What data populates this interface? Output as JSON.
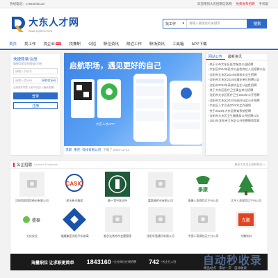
{
  "topbar": {
    "left": "热线电话：17553645120",
    "welcome": "欢迎来到大东招聘信息网",
    "post": "免费发布招聘",
    "mobile": "手机版"
  },
  "logo": {
    "title": "大东人才网",
    "url": "www.sydrcw.com"
  },
  "search": {
    "select": "找工作",
    "placeholder": "请输入要搜索的关键字",
    "button": "搜索"
  },
  "nav": [
    {
      "label": "首页",
      "active": true,
      "badge": ""
    },
    {
      "label": "找工作",
      "active": false,
      "badge": ""
    },
    {
      "label": "找企业",
      "active": false,
      "badge": "new"
    },
    {
      "label": "找兼职",
      "active": false,
      "badge": ""
    },
    {
      "label": "公招",
      "active": false,
      "badge": ""
    },
    {
      "label": "职位资讯",
      "active": false,
      "badge": ""
    },
    {
      "label": "附近工作",
      "active": false,
      "badge": ""
    },
    {
      "label": "职场资讯",
      "active": false,
      "badge": ""
    },
    {
      "label": "工具箱",
      "active": false,
      "badge": ""
    },
    {
      "label": "APP下载",
      "active": false,
      "badge": ""
    }
  ],
  "login": {
    "title": "快捷登录/注册",
    "sub": "请使用验证码登录/注册",
    "phone_placeholder": "请输入手机号",
    "code_placeholder": "请输入验证码",
    "code_button": "获取验证码",
    "agree": "已阅读并同意《用户协议》《隐私政策》",
    "login_button": "登录",
    "register_button": "注册"
  },
  "banner": {
    "headline": "启航职场，遇见更好的自己",
    "app_label": "大东人才APP",
    "caption_tag": "求职",
    "caption_company": "重庆",
    "caption_text": "科技有限公司",
    "caption_date": "下载了 2024-12-21"
  },
  "news": {
    "tabs": [
      "网站公告",
      "最新资讯"
    ],
    "items": [
      "关于公布大东区医疗服务公益招聘",
      "大东区2024年医疗公益性岗位人员招聘公告",
      "沈阳市大东区2024年高校毕业生招聘",
      "沈阳市大东区2024年事业单位招聘公告",
      "沈阳市2024年高校毕业生公益性招聘",
      "关于大东区医疗卫生事业单位招聘",
      "沈阳市大东区医疗卫生2023年公开招聘",
      "沈阳市大东区2024年面向社会公开招聘",
      "大东区人才引进2024年工作通知",
      "关于2024年大东区教育系统招聘",
      "沈阳市大东区卫生健康局公开招聘公告",
      "2024年沈阳市大东区公开招聘教师简章"
    ]
  },
  "enterprise": {
    "title": "名企招聘",
    "title_en": "Famous Enterprise",
    "more": "更多大东名企招聘岗位 >",
    "items": [
      {
        "name": "沈阳西航保险经纪有限公司",
        "logo": "placeholder"
      },
      {
        "name": "航天新光集团",
        "logo": "casic"
      },
      {
        "name": "鞍一堂中医诊所",
        "logo": "seal"
      },
      {
        "name": "嘉惠源药业有限公司",
        "logo": "placeholder"
      },
      {
        "name": "泰康人寿保险辽宁分公司",
        "logo": "taikang"
      },
      {
        "name": "太平人寿保险辽宁分公司",
        "logo": "tree"
      },
      {
        "name": "大庆实业",
        "logo": "shengtai"
      },
      {
        "name": "福耀集团沈阳汽车玻璃",
        "logo": "fuyao"
      },
      {
        "name": "烟台达希哈尔会墅管理",
        "logo": "placeholder"
      },
      {
        "name": "沈阳华强通讯有限公司",
        "logo": "placeholder"
      },
      {
        "name": "中国人寿保险辽宁分公司",
        "logo": "placeholder"
      },
      {
        "name": "东鹏饮料",
        "logo": "dongpeng"
      }
    ]
  },
  "bottom": {
    "slogan": "海量职位 让求职更简单",
    "jobs_count": "1843160",
    "jobs_label": "+企业岗位在线招聘",
    "companies_count": "742",
    "companies_label": "+名企已入驻"
  },
  "watermark": {
    "main": "自动秒收录",
    "sub": "精品站点 · 来访一次 · 自动收录"
  },
  "colors": {
    "brand": "#2d6bc9",
    "accent": "#e23333"
  }
}
